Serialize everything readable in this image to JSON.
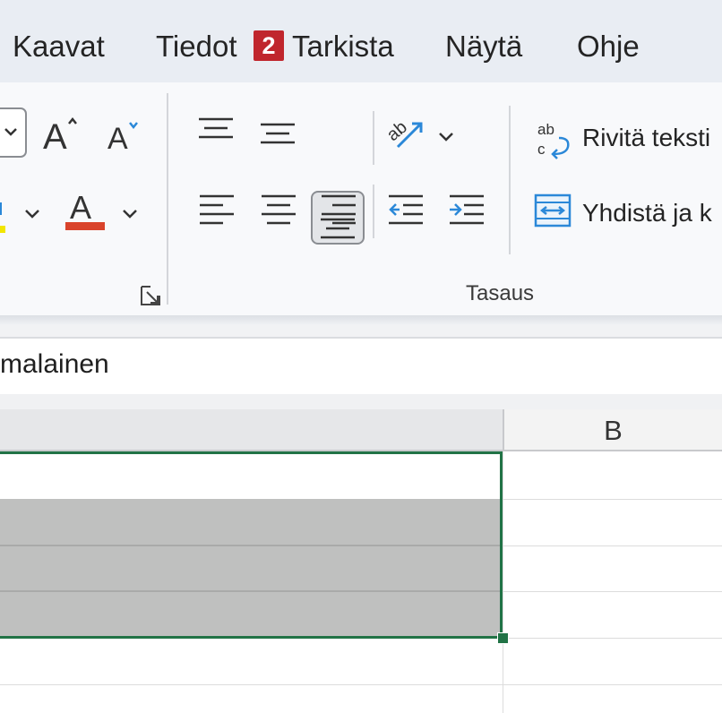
{
  "tabs": {
    "items": [
      {
        "label": "Kaavat"
      },
      {
        "label": "Tiedot"
      },
      {
        "label": "Tarkista"
      },
      {
        "label": "Näytä"
      },
      {
        "label": "Ohje"
      }
    ],
    "badge": "2"
  },
  "ribbon": {
    "wrap_text_label": "Rivitä teksti",
    "merge_label": "Yhdistä ja k",
    "group_alignment_label": "Tasaus",
    "font_color_bar": "#d9432b",
    "highlight_bar": "#f2e600",
    "accent_blue": "#2b88d8"
  },
  "formula_bar": {
    "content": "malainen"
  },
  "sheet": {
    "column_b_header": "B",
    "selection_color": "#217346",
    "selected_fill": "#bfc0bf"
  }
}
